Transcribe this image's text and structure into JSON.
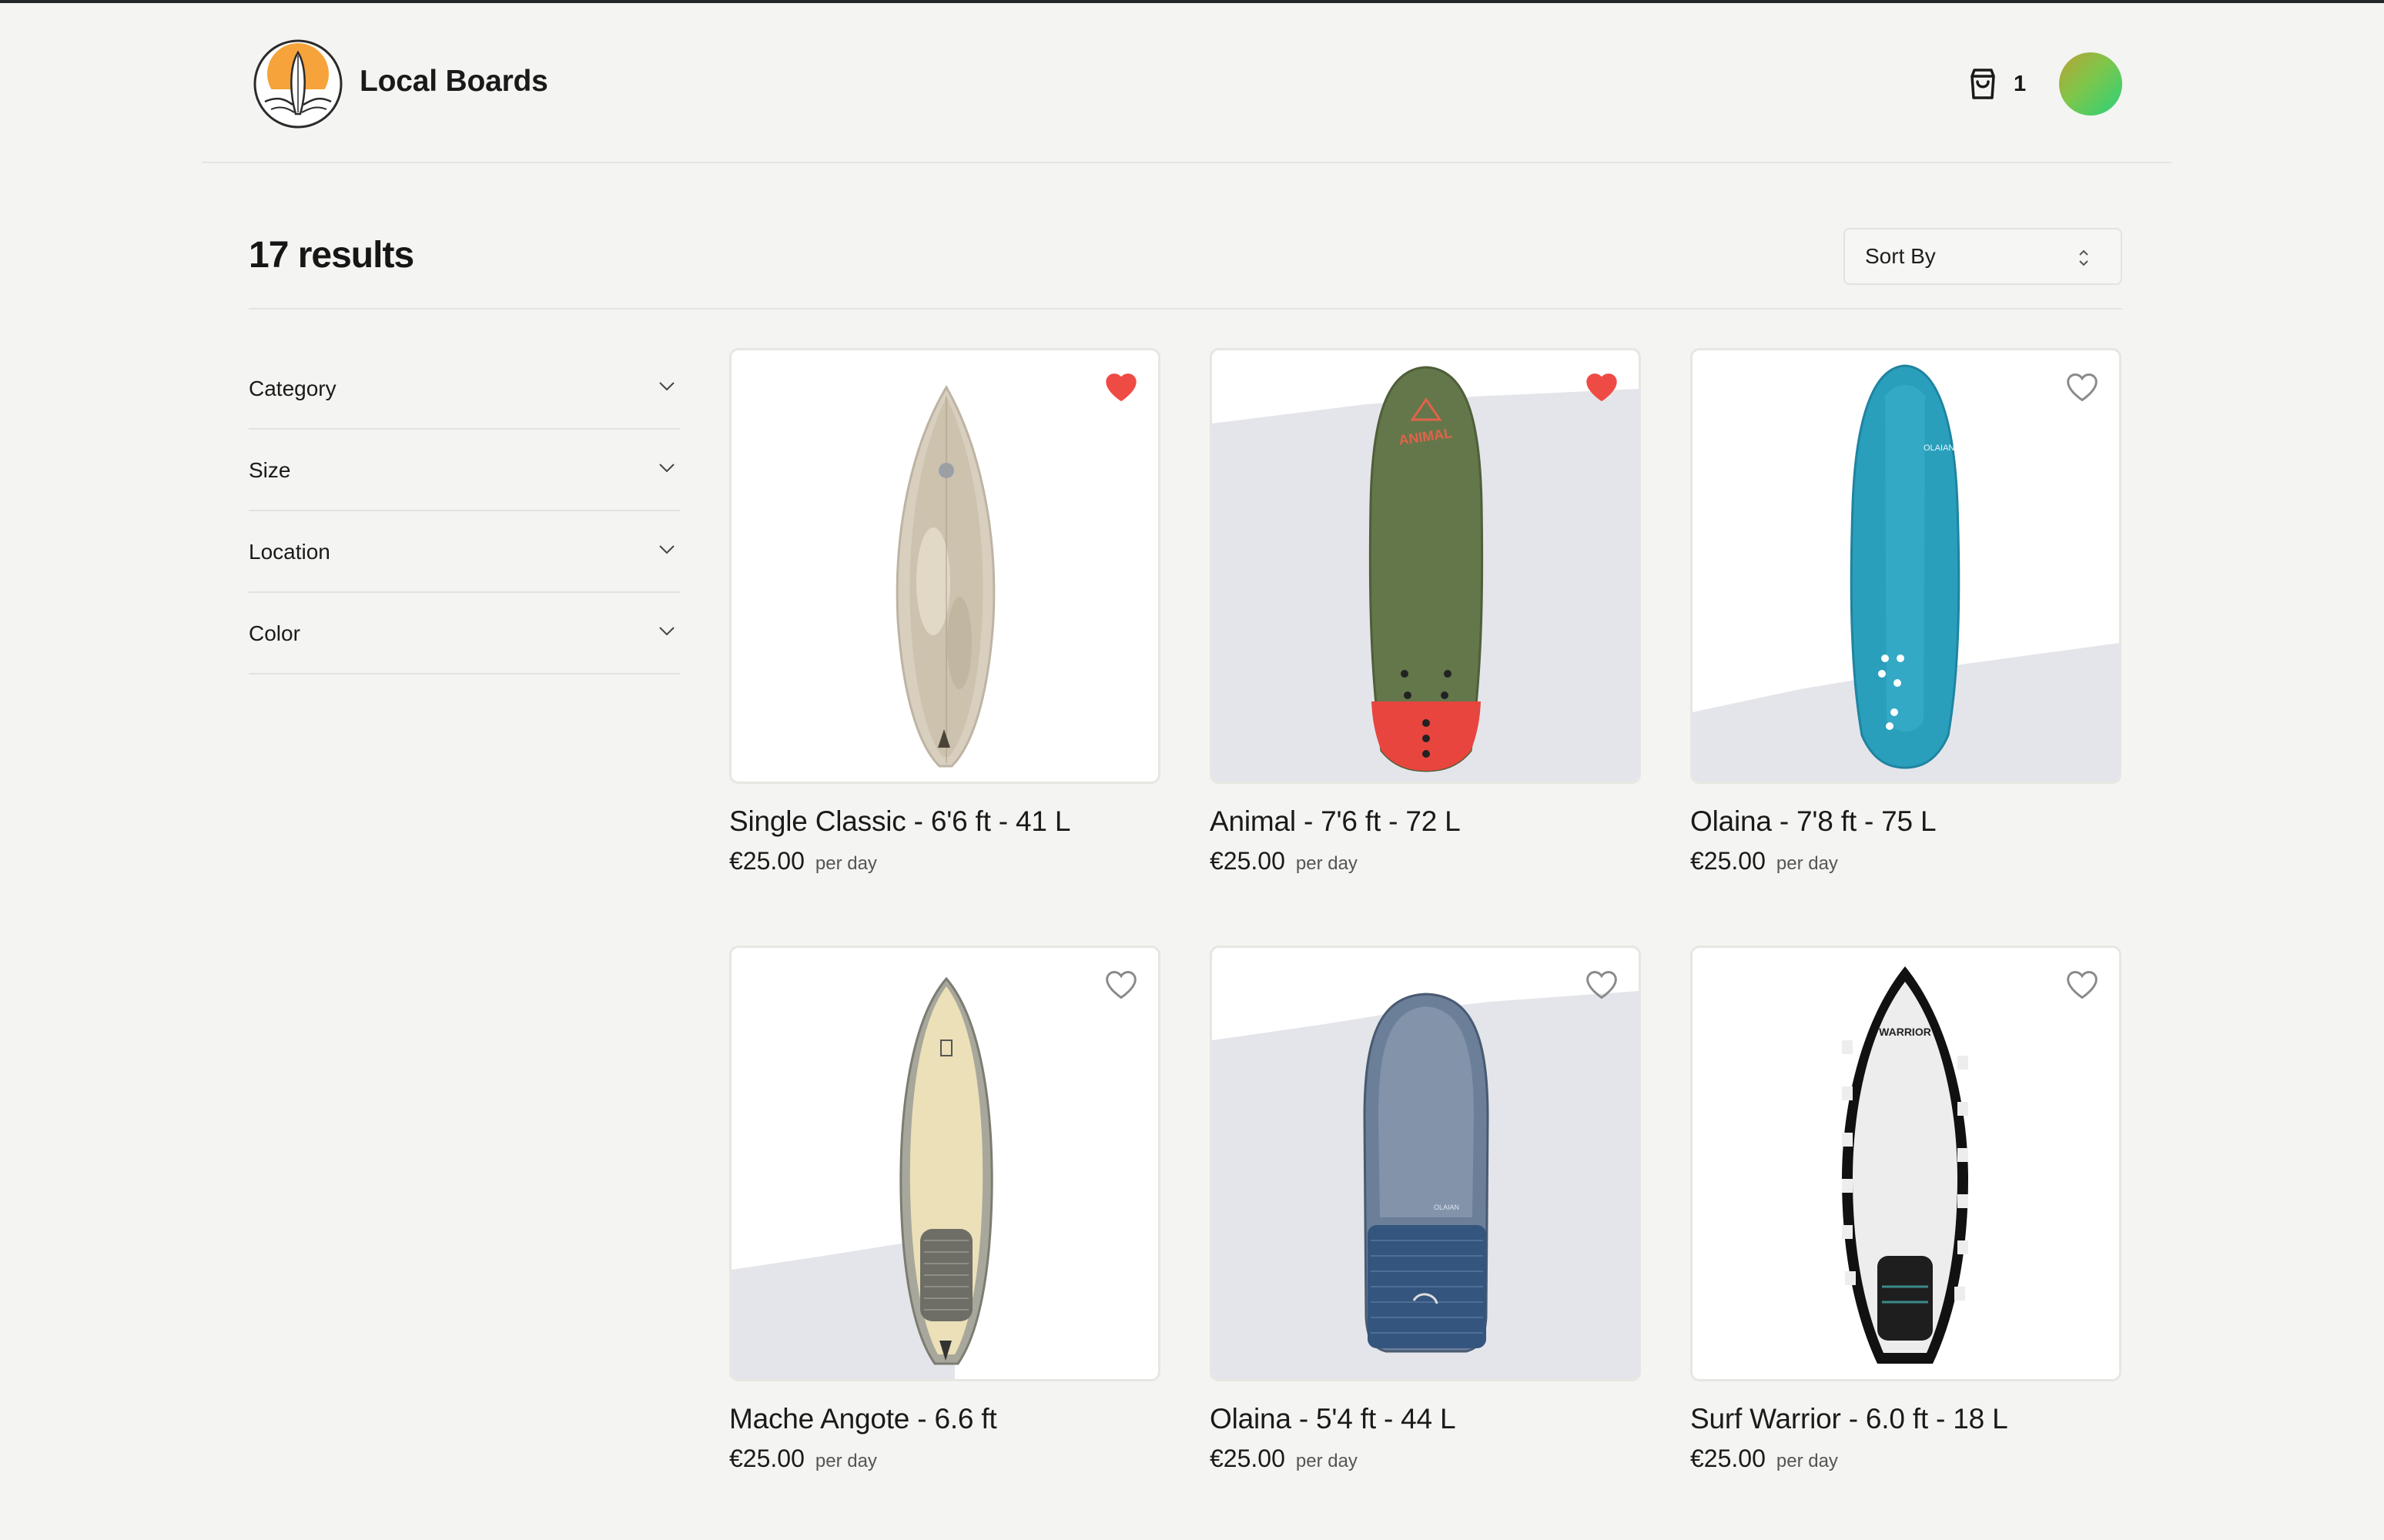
{
  "header": {
    "brand": "Local Boards",
    "cart_count": "1"
  },
  "results": {
    "title": "17 results",
    "sort_label": "Sort By"
  },
  "filters": [
    {
      "label": "Category"
    },
    {
      "label": "Size"
    },
    {
      "label": "Location"
    },
    {
      "label": "Color"
    }
  ],
  "products": [
    {
      "title": "Single Classic - 6'6 ft - 41 L",
      "price": "€25.00",
      "per": "per day",
      "favorite": true
    },
    {
      "title": "Animal - 7'6 ft - 72 L",
      "price": "€25.00",
      "per": "per day",
      "favorite": true
    },
    {
      "title": "Olaina - 7'8 ft - 75 L",
      "price": "€25.00",
      "per": "per day",
      "favorite": false
    },
    {
      "title": "Mache Angote - 6.6 ft",
      "price": "€25.00",
      "per": "per day",
      "favorite": false
    },
    {
      "title": "Olaina - 5'4 ft - 44 L",
      "price": "€25.00",
      "per": "per day",
      "favorite": false
    },
    {
      "title": "Surf Warrior - 6.0 ft - 18 L",
      "price": "€25.00",
      "per": "per day",
      "favorite": false
    }
  ],
  "colors": {
    "favorite_active": "#ef4b45",
    "favorite_inactive": "#8a8a8a",
    "logo_sun": "#f5a33a"
  }
}
